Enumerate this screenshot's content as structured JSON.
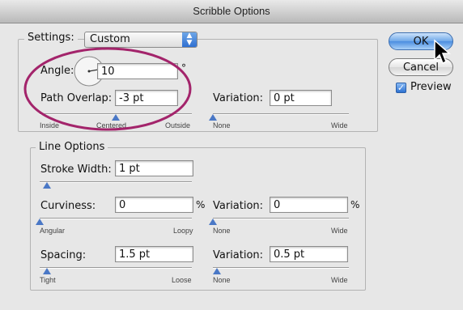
{
  "window": {
    "title": "Scribble Options"
  },
  "settings": {
    "label": "Settings:",
    "preset": "Custom"
  },
  "angle": {
    "label": "Angle:",
    "value": "10",
    "unit": "°"
  },
  "path_overlap": {
    "label": "Path Overlap:",
    "value": "-3 pt",
    "variation_label": "Variation:",
    "variation_value": "0 pt",
    "slider": {
      "left": "Inside",
      "mid": "Centered",
      "right": "Outside",
      "position": 0.5
    },
    "variation_slider": {
      "left": "None",
      "right": "Wide",
      "position": 0.0
    }
  },
  "line_options": {
    "legend": "Line Options",
    "stroke_width": {
      "label": "Stroke Width:",
      "value": "1 pt",
      "slider_position": 0.05
    },
    "curviness": {
      "label": "Curviness:",
      "value": "0",
      "unit": "%",
      "variation_label": "Variation:",
      "variation_value": "0",
      "variation_unit": "%",
      "slider": {
        "left": "Angular",
        "right": "Loopy",
        "position": 0.0
      },
      "variation_slider": {
        "left": "None",
        "right": "Wide",
        "position": 0.0
      }
    },
    "spacing": {
      "label": "Spacing:",
      "value": "1.5 pt",
      "variation_label": "Variation:",
      "variation_value": "0.5 pt",
      "slider": {
        "left": "Tight",
        "right": "Loose",
        "position": 0.05
      },
      "variation_slider": {
        "left": "None",
        "right": "Wide",
        "position": 0.03
      }
    }
  },
  "buttons": {
    "ok": "OK",
    "cancel": "Cancel"
  },
  "preview": {
    "label": "Preview",
    "checked": true
  },
  "colors": {
    "annotation_circle": "#a3246b",
    "thumb": "#4a78c6",
    "accent": "#4b8ee0"
  }
}
